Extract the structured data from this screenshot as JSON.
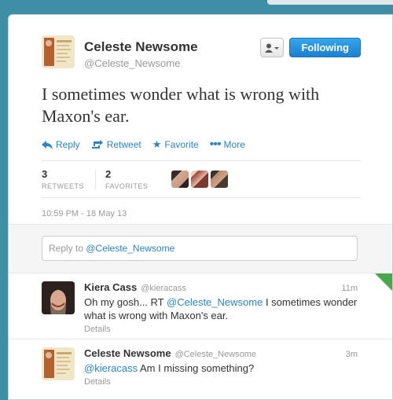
{
  "tweet": {
    "author_name": "Celeste Newsome",
    "author_handle": "@Celeste_Newsome",
    "follow_label": "Following",
    "text": "I sometimes wonder what is wrong with Maxon's ear.",
    "actions": {
      "reply": "Reply",
      "retweet": "Retweet",
      "favorite": "Favorite",
      "more": "More"
    },
    "stats": {
      "retweets_count": "3",
      "retweets_label": "RETWEETS",
      "favorites_count": "2",
      "favorites_label": "FAVORITES"
    },
    "timestamp": "10:59 PM - 18 May 13"
  },
  "reply_box": {
    "prefix": "Reply to ",
    "mention": "@Celeste_Newsome"
  },
  "replies": [
    {
      "name": "Kiera Cass",
      "handle": "@kieracass",
      "time": "11m",
      "text_prefix": "Oh my gosh... RT ",
      "mention": "@Celeste_Newsome",
      "text_suffix": " I sometimes wonder what is wrong with Maxon's ear.",
      "details": "Details"
    },
    {
      "name": "Celeste Newsome",
      "handle": "@Celeste_Newsome",
      "time": "3m",
      "mention": "@kieracass",
      "text_suffix": " Am I missing something?",
      "details": "Details"
    }
  ],
  "colors": {
    "background": "#3d8fa6",
    "link": "#2a85c2",
    "follow_button": "#1d7fd0"
  }
}
